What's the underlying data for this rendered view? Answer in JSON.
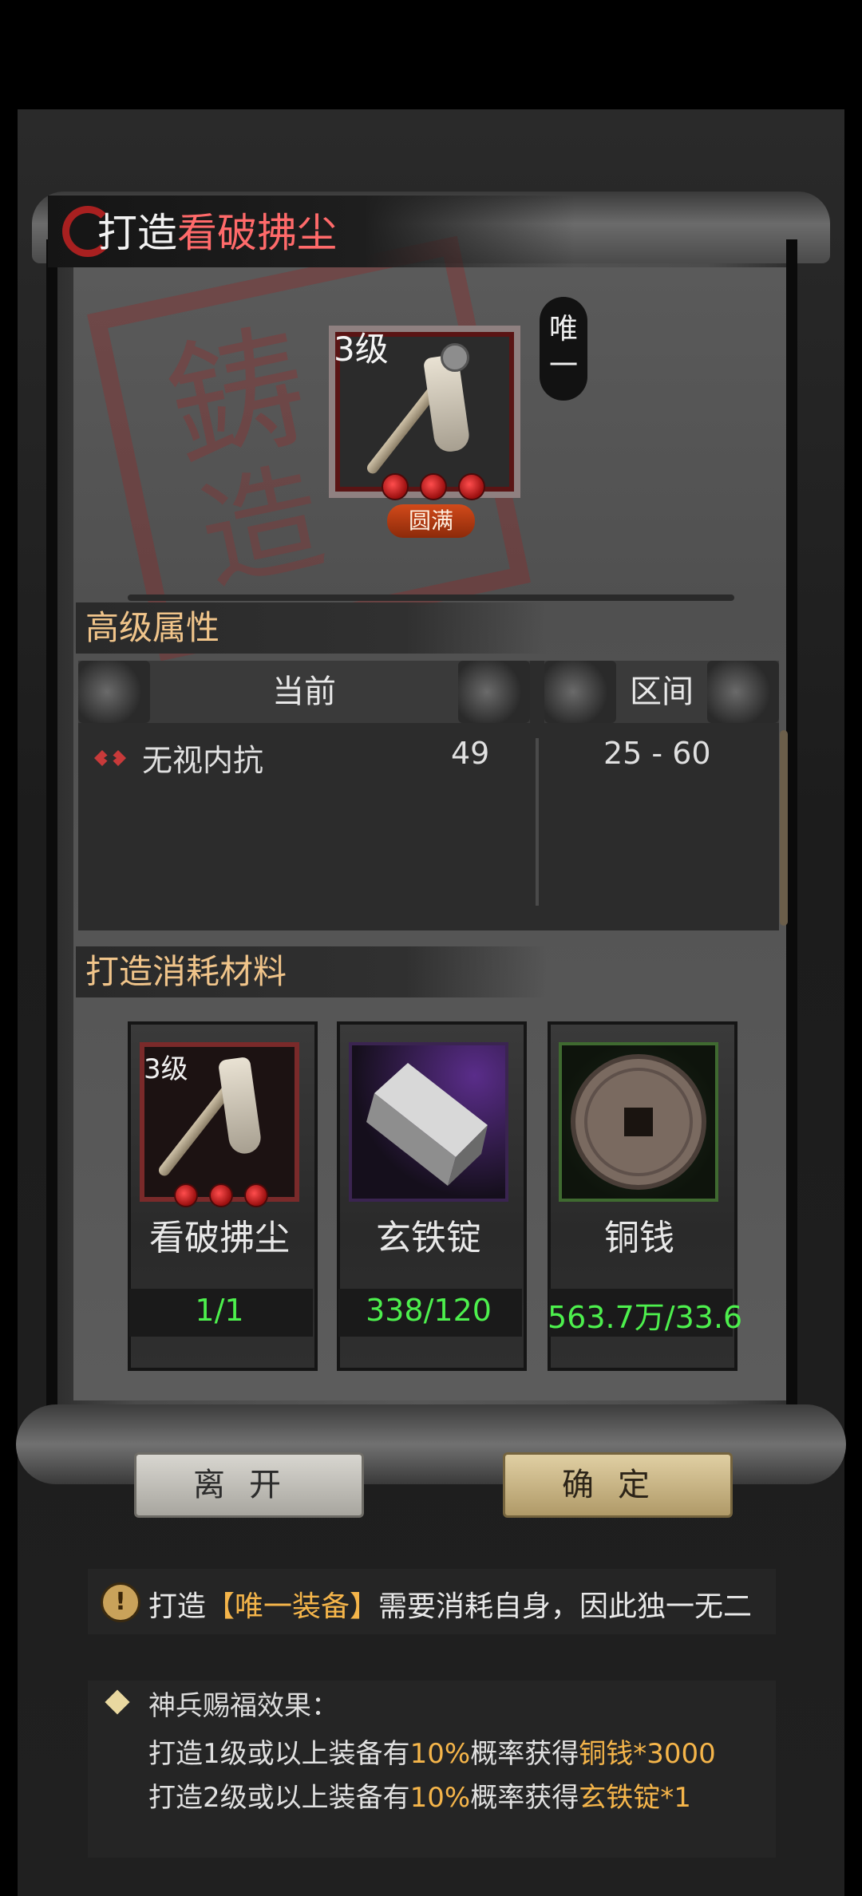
{
  "title": {
    "prefix": "打造",
    "item": "看破拂尘"
  },
  "seal_text": {
    "char1": "鋳",
    "char2": "造"
  },
  "top_item": {
    "level": "3级",
    "quality_badge": "圆满",
    "unique_tag_line1": "唯",
    "unique_tag_line2": "一",
    "gems": 3
  },
  "advanced_attrs": {
    "section_title": "高级属性",
    "col_current": "当前",
    "col_range": "区间",
    "rows": [
      {
        "name": "无视内抗",
        "value": "49",
        "range": "25 - 60"
      }
    ]
  },
  "materials": {
    "section_title": "打造消耗材料",
    "items": [
      {
        "level": "3级",
        "name": "看破拂尘",
        "count": "1/1",
        "frame_color": "#7a2a2a"
      },
      {
        "name": "玄铁锭",
        "count": "338/120",
        "frame_color": "#6a3a9a"
      },
      {
        "name": "铜钱",
        "count": "563.7万/33.6",
        "frame_color": "#4a7a3a"
      }
    ]
  },
  "buttons": {
    "leave": "离开",
    "confirm": "确定"
  },
  "notice1": {
    "icon": "!",
    "text_before": "打造",
    "highlight": "【唯一装备】",
    "text_after": "需要消耗自身，因此独一无二"
  },
  "notice2": {
    "title": "神兵赐福效果：",
    "line1": {
      "a": "打造1级或以上装备有",
      "b": "10%",
      "c": "概率获得",
      "d": "铜钱*3000"
    },
    "line2": {
      "a": "打造2级或以上装备有",
      "b": "10%",
      "c": "概率获得",
      "d": "玄铁锭*1"
    }
  },
  "colors": {
    "highlight": "#f5b54a",
    "count_green": "#4df04d",
    "section_gold": "#f0c48a",
    "title_red": "#ff6a6a"
  }
}
